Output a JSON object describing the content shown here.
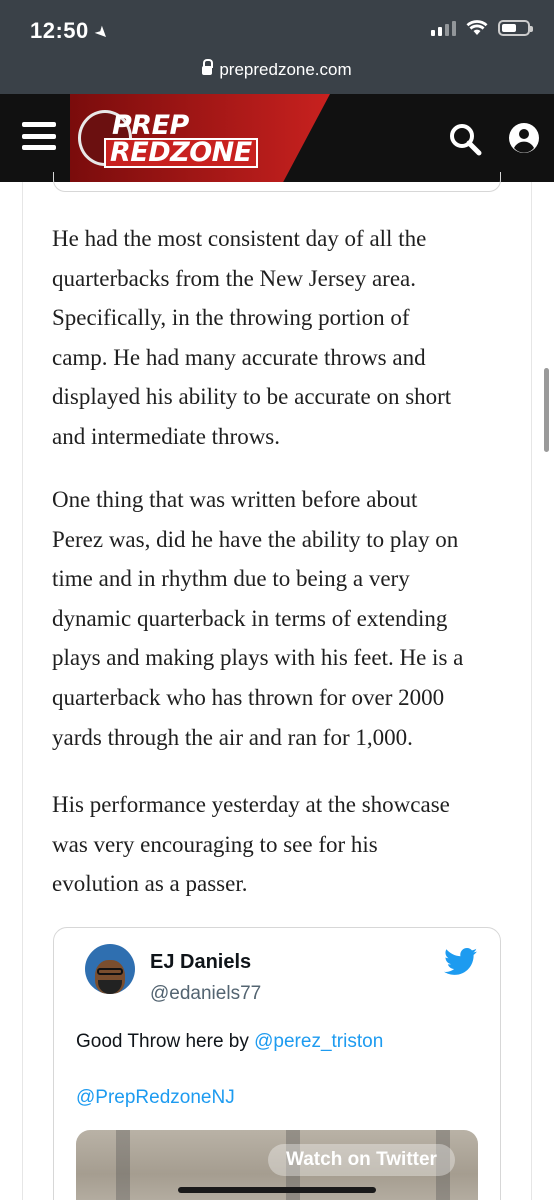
{
  "status_bar": {
    "time": "12:50",
    "battery_level": 0.6
  },
  "browser": {
    "url": "prepredzone.com"
  },
  "site": {
    "logo_line1": "PREP",
    "logo_line2": "REDZONE"
  },
  "article": {
    "paragraphs": [
      {
        "lines": [
          "He had the most consistent day of all the",
          "quarterbacks from the New Jersey area.",
          "Specifically,  in the throwing portion of",
          "camp. He had many accurate throws and",
          "displayed his ability to be accurate on short",
          "and intermediate throws."
        ]
      },
      {
        "lines": [
          "One thing that was written before about",
          "Perez was, did he have the ability to play on",
          "time and in rhythm due to being a very",
          "dynamic quarterback in terms of extending",
          "plays and making plays with his feet. He is a",
          "quarterback who has thrown for over 2000",
          "yards through the air and ran for 1,000."
        ]
      },
      {
        "lines": [
          "His performance yesterday at the showcase",
          "was very encouraging to see for his",
          "evolution as a passer."
        ]
      }
    ]
  },
  "tweet": {
    "name": "EJ Daniels",
    "handle": "@edaniels77",
    "text_prefix": "Good Throw here by ",
    "mention": "@perez_triston",
    "tag": "@PrepRedzoneNJ",
    "watch_label": "Watch on Twitter"
  },
  "colors": {
    "status_bar_bg": "#3a4148",
    "header_bg": "#111111",
    "brand_red": "#c8211f",
    "twitter_blue": "#1d9bf0"
  }
}
